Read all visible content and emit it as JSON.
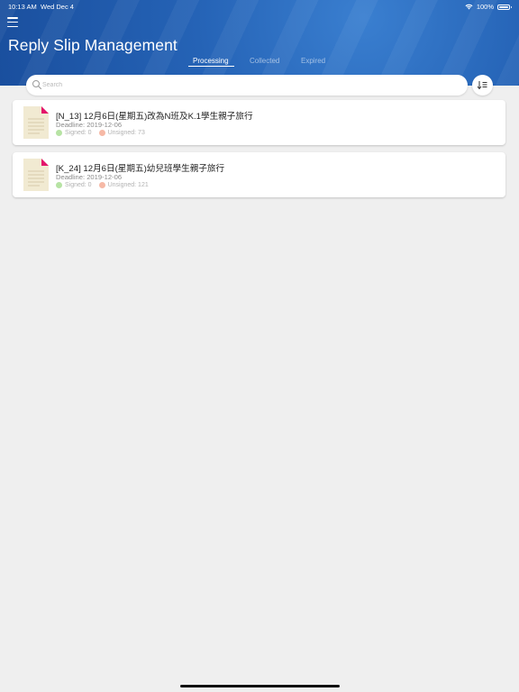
{
  "status_bar": {
    "time": "10:13 AM",
    "date": "Wed Dec 4",
    "battery_percent": "100%"
  },
  "header": {
    "title": "Reply Slip Management",
    "tabs": [
      {
        "label": "Processing",
        "active": true
      },
      {
        "label": "Collected",
        "active": false
      },
      {
        "label": "Expired",
        "active": false
      }
    ]
  },
  "search": {
    "placeholder": "Search",
    "value": ""
  },
  "slips": [
    {
      "title": "[N_13] 12月6日(星期五)改為N班及K.1學生親子旅行",
      "deadline": "Deadline: 2019-12-06",
      "signed": "Signed: 0",
      "unsigned": "Unsigned: 73"
    },
    {
      "title": "[K_24] 12月6日(星期五)幼兒班學生親子旅行",
      "deadline": "Deadline: 2019-12-06",
      "signed": "Signed: 0",
      "unsigned": "Unsigned: 121"
    }
  ],
  "colors": {
    "header_blue": "#2563b6",
    "page_background": "#efefef",
    "signed_dot": "#b7e3a4",
    "unsigned_dot": "#f6b9a6",
    "doc_corner": "#e3156b"
  },
  "icons": {
    "menu": "hamburger-icon",
    "search": "search-icon",
    "sort": "sort-icon",
    "document": "document-icon",
    "wifi": "wifi-icon",
    "battery": "battery-icon"
  }
}
